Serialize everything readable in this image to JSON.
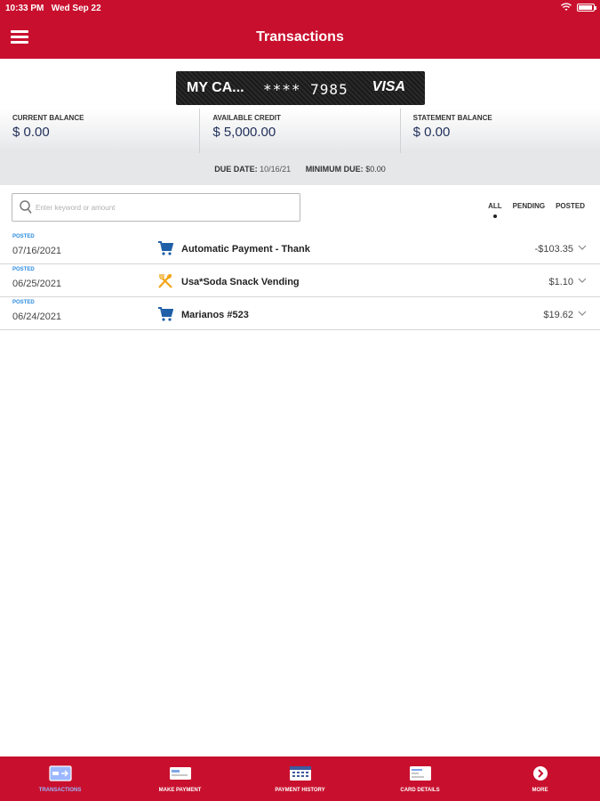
{
  "status_bar": {
    "time": "10:33 PM",
    "date": "Wed Sep 22"
  },
  "header": {
    "title": "Transactions"
  },
  "card": {
    "name": "MY CA...",
    "number_masked": "**** 7985",
    "brand": "VISA"
  },
  "balances": [
    {
      "label": "CURRENT BALANCE",
      "value": "$ 0.00"
    },
    {
      "label": "AVAILABLE CREDIT",
      "value": "$ 5,000.00"
    },
    {
      "label": "STATEMENT BALANCE",
      "value": "$ 0.00"
    }
  ],
  "due": {
    "due_date_label": "DUE DATE:",
    "due_date_value": "10/16/21",
    "minimum_due_label": "MINIMUM DUE:",
    "minimum_due_value": "$0.00"
  },
  "search": {
    "placeholder": "Enter keyword or amount"
  },
  "filters": {
    "all": "ALL",
    "pending": "PENDING",
    "posted": "POSTED",
    "active": "ALL"
  },
  "transactions": [
    {
      "status": "POSTED",
      "date": "07/16/2021",
      "icon": "cart-icon",
      "description": "Automatic Payment - Thank",
      "amount": "-$103.35"
    },
    {
      "status": "POSTED",
      "date": "06/25/2021",
      "icon": "fork-knife-icon",
      "description": "Usa*Soda Snack Vending",
      "amount": "$1.10"
    },
    {
      "status": "POSTED",
      "date": "06/24/2021",
      "icon": "cart-icon",
      "description": "Marianos #523",
      "amount": "$19.62"
    }
  ],
  "bottom_nav": [
    {
      "label": "TRANSACTIONS",
      "icon": "transactions-icon",
      "active": true
    },
    {
      "label": "MAKE PAYMENT",
      "icon": "make-payment-icon",
      "active": false
    },
    {
      "label": "PAYMENT HISTORY",
      "icon": "payment-history-icon",
      "active": false
    },
    {
      "label": "CARD DETAILS",
      "icon": "card-details-icon",
      "active": false
    },
    {
      "label": "MORE",
      "icon": "more-icon",
      "active": false
    }
  ],
  "colors": {
    "brand_red": "#c8102e",
    "posted_blue": "#2a8be0",
    "cart_blue": "#1f5fa8",
    "food_orange": "#f2a516"
  }
}
